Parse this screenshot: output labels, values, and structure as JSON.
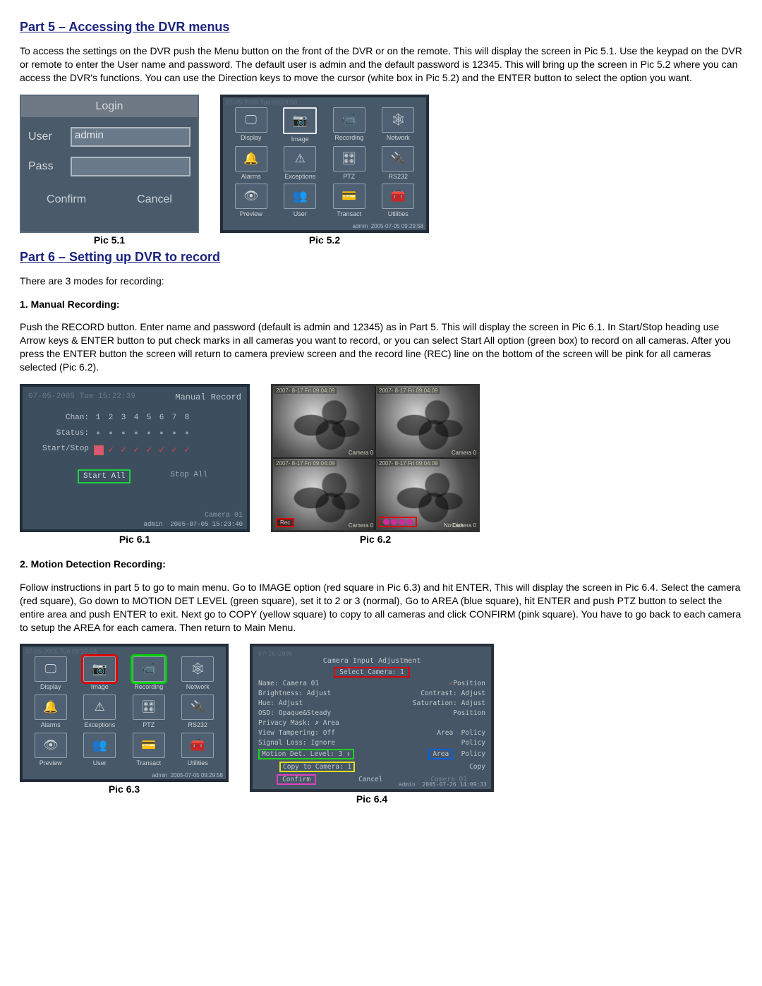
{
  "section5": {
    "heading": "Part 5 – Accessing the DVR menus",
    "para": "To access the settings on the DVR push the Menu button on the front of the DVR or on the remote. This will display the screen in Pic 5.1. Use the keypad on the DVR or remote to enter the User name and password. The default user is admin and the default password is 12345. This will bring up the screen in Pic 5.2 where you can access the DVR's functions.  You can use the Direction keys to move the cursor (white box in Pic 5.2) and the ENTER button to select the option you want."
  },
  "pic51": {
    "caption": "Pic 5.1",
    "title": "Login",
    "user_label": "User",
    "user_value": "admin",
    "pass_label": "Pass",
    "confirm": "Confirm",
    "cancel": "Cancel"
  },
  "pic52": {
    "caption": "Pic 5.2",
    "datetime_top": "07-05-2005 Tue 09:29:58",
    "items": [
      "Display",
      "Image",
      "Recording",
      "Network",
      "Alarms",
      "Exceptions",
      "PTZ",
      "RS232",
      "Preview",
      "User",
      "Transact",
      "Utilities"
    ],
    "icons": [
      "🖵",
      "📷",
      "📹",
      "🕸",
      "🔔",
      "⚠",
      "🎛",
      "🔌",
      "👁",
      "👥",
      "💳",
      "🧰"
    ],
    "footer_user": "admin",
    "footer_time": "2005-07-05 09:29:58"
  },
  "section6": {
    "heading": "Part 6 – Setting up DVR to record",
    "intro": "There are 3 modes for recording:",
    "sub1": "1. Manual Recording:",
    "para1": " Push the RECORD button. Enter name and password (default is admin and 12345) as in Part 5. This will display the screen in Pic 6.1. In Start/Stop heading use Arrow keys & ENTER button to put check marks in all cameras you want to record, or you can select Start All option (green box) to record on all cameras. After you press the ENTER button the screen will return to camera preview screen and the record line (REC) line on the bottom of the screen will be pink for all cameras selected (Pic 6.2).",
    "sub2": "2. Motion Detection Recording:",
    "para2": "Follow instructions in part 5 to go to main menu. Go to IMAGE option (red square in Pic 6.3) and hit ENTER, This will display the screen in Pic 6.4. Select the camera (red square), Go down to MOTION DET LEVEL (green square), set it to 2 or 3 (normal), Go to AREA (blue square), hit ENTER and push PTZ button to select the entire area and push ENTER to exit. Next go to COPY (yellow square) to copy to all cameras and click CONFIRM (pink square). You have to go back to each camera to setup the AREA for each camera. Then return to Main Menu."
  },
  "pic61": {
    "caption": "Pic 6.1",
    "title": "Manual Record",
    "dateline": "07-05-2005 Tue 15:22:39",
    "chan_label": "Chan:",
    "chans": [
      "1",
      "2",
      "3",
      "4",
      "5",
      "6",
      "7",
      "8"
    ],
    "status_label": "Status:",
    "ss_label": "Start/Stop",
    "start_all": "Start All",
    "stop_all": "Stop All",
    "camera": "Camera 01",
    "footer_user": "admin",
    "footer_time": "2005-07-05 15:23:40"
  },
  "pic62": {
    "caption": "Pic 6.2",
    "ts": "2007- 8-17 Fri 09:04:09",
    "cam": "Camera 0",
    "rec": "Rec",
    "nodisk": "No Disk"
  },
  "pic63": {
    "caption": "Pic 6.3"
  },
  "pic64": {
    "caption": "Pic 6.4",
    "title": "Camera Input Adjustment",
    "dateline": "07-26-2005",
    "select_camera": "Select Camera: 1",
    "name_label": "Name:",
    "name_value": "Camera 01",
    "position": "Position",
    "brightness": "Brightness:",
    "adjust": "Adjust",
    "contrast": "Contrast:",
    "hue": "Hue:",
    "saturation": "Saturation:",
    "osd": "OSD:",
    "osd_value": "Opaque&Steady",
    "privacy": "Privacy Mask:",
    "privacy_value": "✗   Area",
    "viewtamp": "View Tampering:",
    "viewtamp_value": "Off",
    "area": "Area",
    "policy": "Policy",
    "sigloss": "Signal Loss:",
    "sigloss_value": "Ignore",
    "motion": "Motion Det. Level:",
    "motion_value": "3 ⇕",
    "copyto": "Copy to Camera: 1",
    "copy": "Copy",
    "confirm": "Confirm",
    "cancel": "Cancel",
    "footer_time": "2005-07-26 14:09:33",
    "footer_user": "admin",
    "cam_foot": "Camera 01"
  }
}
